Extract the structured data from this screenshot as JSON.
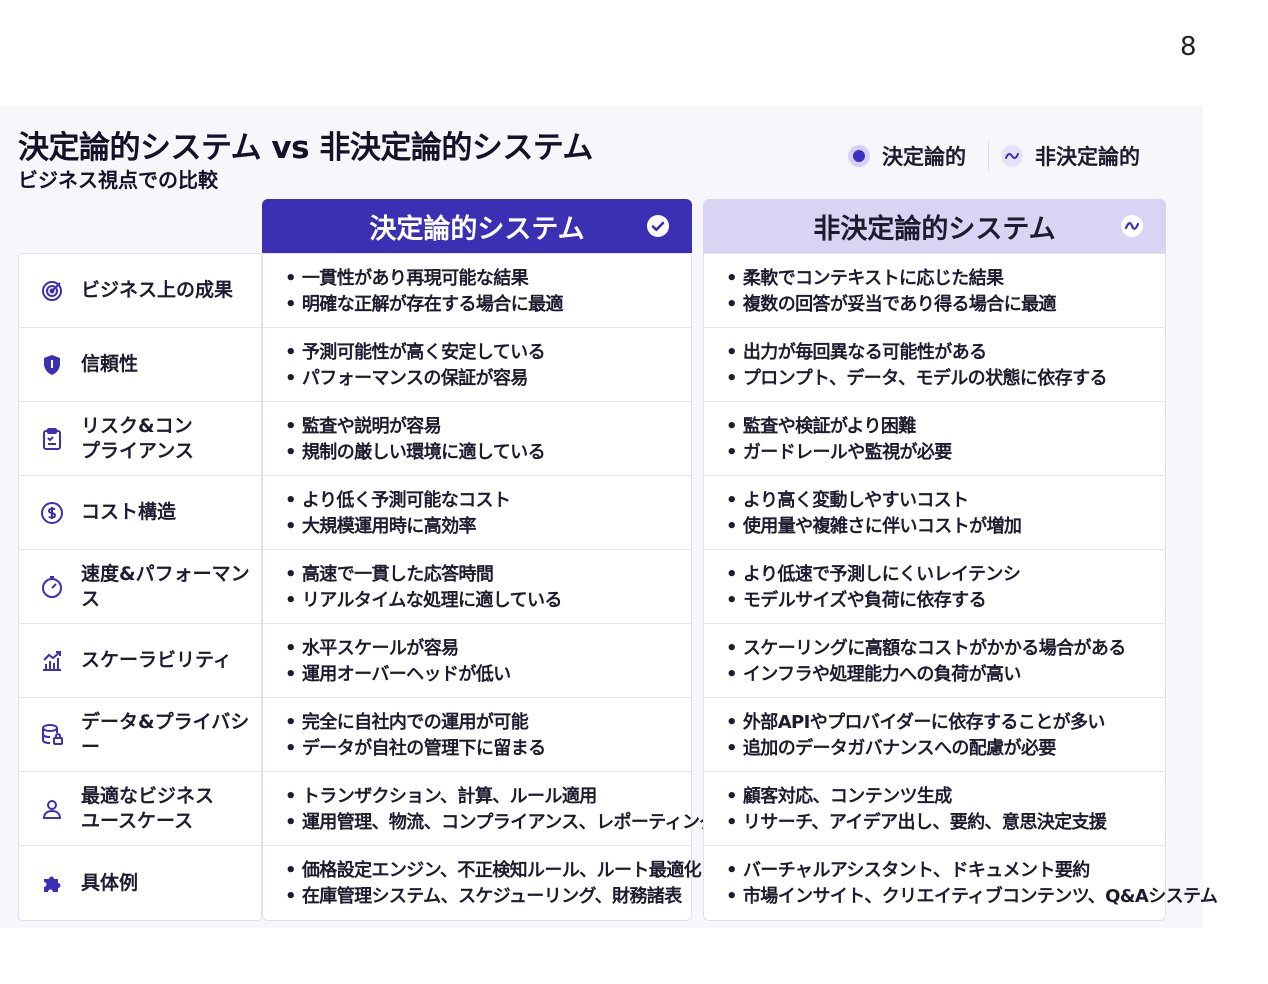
{
  "page_number": "8",
  "title": "決定論的システム vs 非決定論的システム",
  "subtitle": "ビジネス視点での比較",
  "legend": {
    "deterministic": "決定論的",
    "nondeterministic": "非決定論的"
  },
  "columns": {
    "deterministic": "決定論的システム",
    "nondeterministic": "非決定論的システム"
  },
  "colors": {
    "accent": "#3b2fb3",
    "accent_light": "#d9d3f4"
  },
  "rows": [
    {
      "icon": "target-icon",
      "label": "ビジネス上の成果",
      "det": [
        "一貫性があり再現可能な結果",
        "明確な正解が存在する場合に最適"
      ],
      "nondet": [
        "柔軟でコンテキストに応じた結果",
        "複数の回答が妥当であり得る場合に最適"
      ]
    },
    {
      "icon": "shield-icon",
      "label": "信頼性",
      "det": [
        "予測可能性が高く安定している",
        "パフォーマンスの保証が容易"
      ],
      "nondet": [
        "出力が毎回異なる可能性がある",
        "プロンプト、データ、モデルの状態に依存する"
      ]
    },
    {
      "icon": "clipboard-icon",
      "label": "リスク&コン\nプライアンス",
      "det": [
        "監査や説明が容易",
        "規制の厳しい環境に適している"
      ],
      "nondet": [
        "監査や検証がより困難",
        "ガードレールや監視が必要"
      ]
    },
    {
      "icon": "dollar-icon",
      "label": "コスト構造",
      "det": [
        "より低く予測可能なコスト",
        "大規模運用時に高効率"
      ],
      "nondet": [
        "より高く変動しやすいコスト",
        "使用量や複雑さに伴いコストが増加"
      ]
    },
    {
      "icon": "gauge-icon",
      "label": "速度&パフォーマンス",
      "det": [
        "高速で一貫した応答時間",
        "リアルタイムな処理に適している"
      ],
      "nondet": [
        "より低速で予測しにくいレイテンシ",
        "モデルサイズや負荷に依存する"
      ]
    },
    {
      "icon": "growth-chart-icon",
      "label": "スケーラビリティ",
      "det": [
        "水平スケールが容易",
        "運用オーバーヘッドが低い"
      ],
      "nondet": [
        "スケーリングに高額なコストがかかる場合がある",
        "インフラや処理能力への負荷が高い"
      ]
    },
    {
      "icon": "database-lock-icon",
      "label": "データ&プライバシー",
      "det": [
        "完全に自社内での運用が可能",
        "データが自社の管理下に留まる"
      ],
      "nondet": [
        "外部APIやプロバイダーに依存することが多い",
        "追加のデータガバナンスへの配慮が必要"
      ]
    },
    {
      "icon": "user-icon",
      "label": "最適なビジネス\nユースケース",
      "det": [
        "トランザクション、計算、ルール適用",
        "運用管理、物流、コンプライアンス、レポーティング"
      ],
      "nondet": [
        "顧客対応、コンテンツ生成",
        "リサーチ、アイデア出し、要約、意思決定支援"
      ]
    },
    {
      "icon": "puzzle-icon",
      "label": "具体例",
      "det": [
        "価格設定エンジン、不正検知ルール、ルート最適化",
        "在庫管理システム、スケジューリング、財務諸表"
      ],
      "nondet": [
        "バーチャルアシスタント、ドキュメント要約",
        "市場インサイト、クリエイティブコンテンツ、Q&Aシステム"
      ]
    }
  ]
}
